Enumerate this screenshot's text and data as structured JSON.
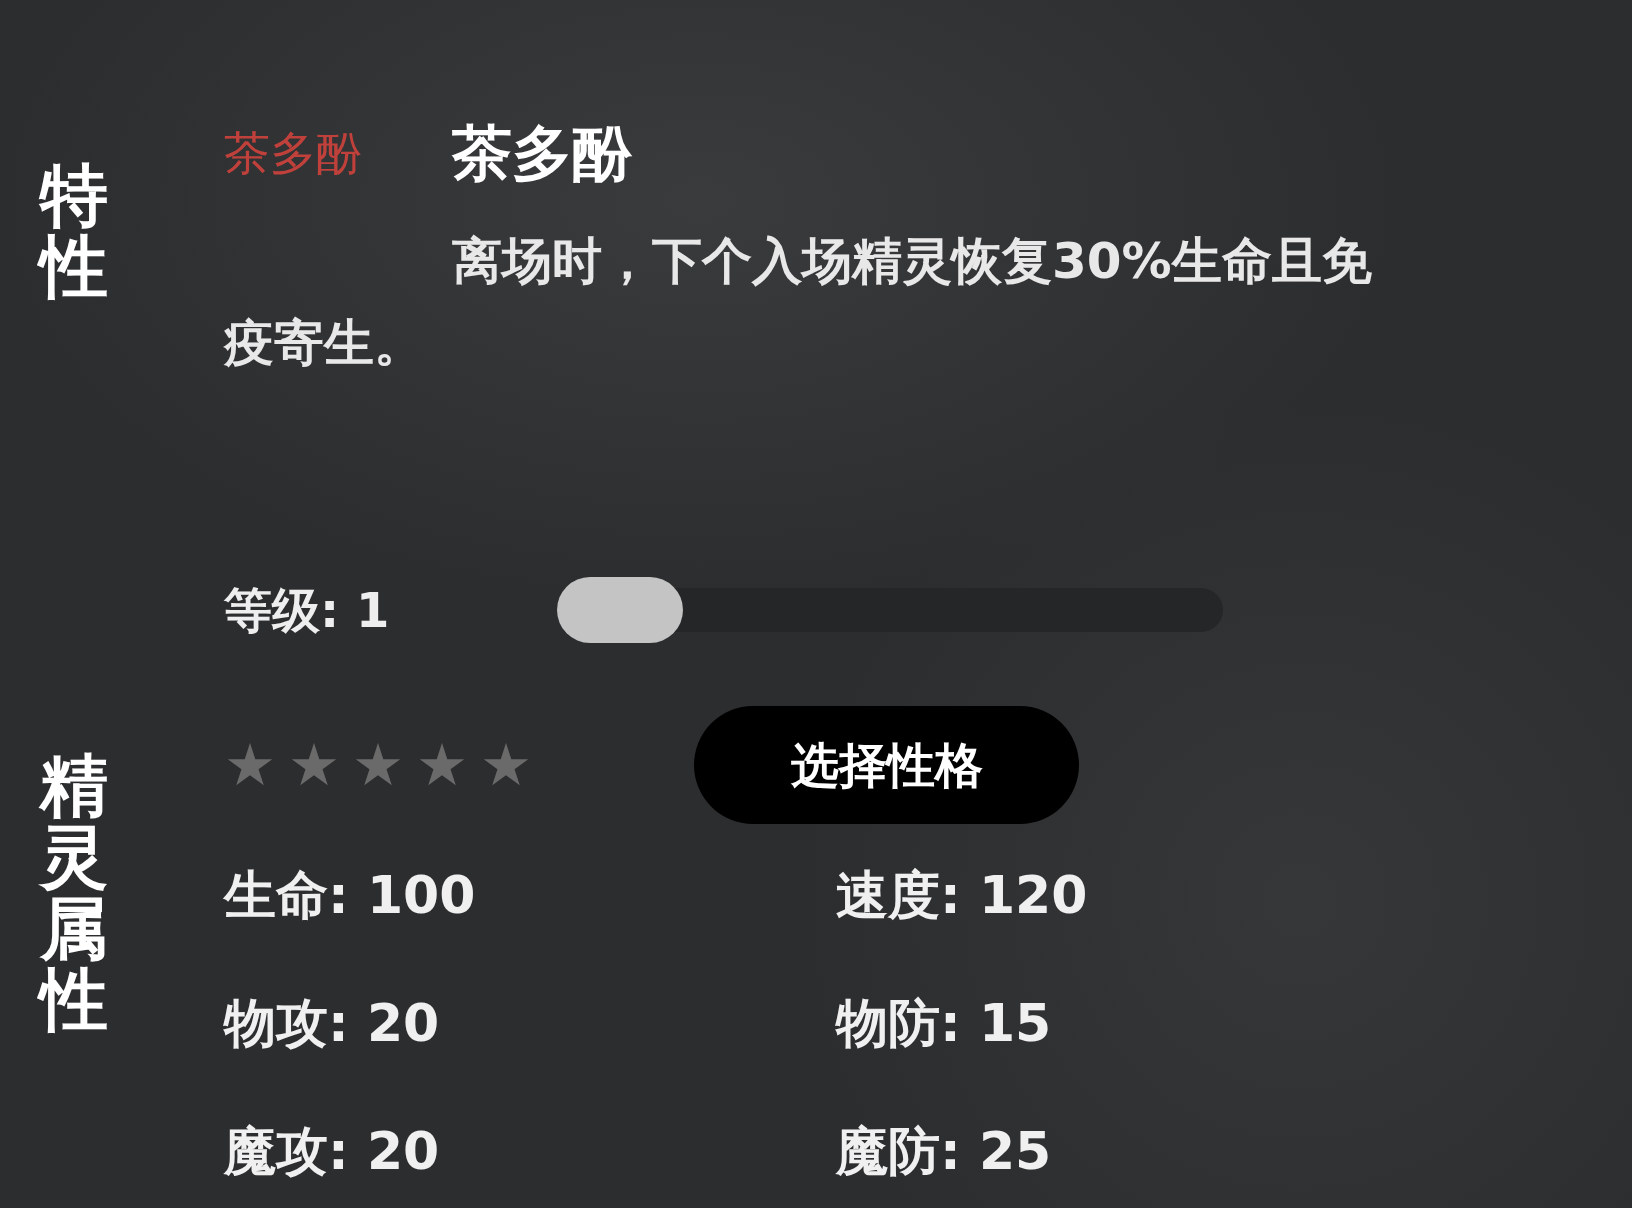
{
  "side_labels": [
    "特性",
    "精灵属性"
  ],
  "trait": {
    "tag": "茶多酚",
    "name": "茶多酚",
    "description": "离场时，下个入场精灵恢复30%生命且免疫寄生。"
  },
  "level": {
    "label": "等级: 1",
    "level": 0
  },
  "stars": 5,
  "nature_button": "选择性格",
  "stats": [
    "生命: 100",
    "速度: 120",
    "物攻: 20",
    "物防: 15",
    "魔攻: 20",
    "魔防: 25"
  ]
}
